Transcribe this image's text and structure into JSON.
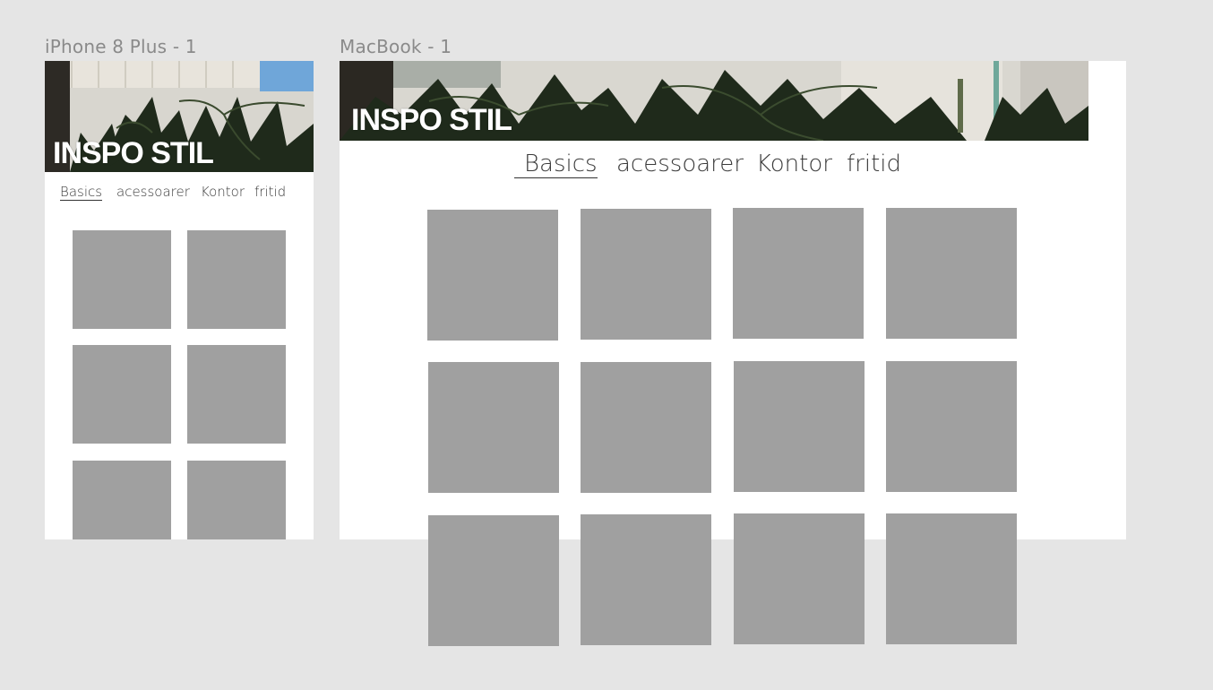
{
  "frames": {
    "iphone": {
      "label": "iPhone 8 Plus - 1"
    },
    "macbook": {
      "label": "MacBook - 1"
    }
  },
  "hero": {
    "title": "INSPO STIL"
  },
  "nav": {
    "items": [
      "Basics",
      "acessoarer",
      "Kontor",
      "fritid"
    ],
    "active": "Basics"
  },
  "colors": {
    "canvas": "#e5e5e5",
    "frame_bg": "#ffffff",
    "tile": "#a0a0a0",
    "title": "#ffffff",
    "foliage": "#1f2a1b"
  },
  "grids": {
    "iphone": {
      "columns": 2,
      "rows": 3
    },
    "macbook": {
      "columns": 4,
      "rows": 3
    }
  }
}
